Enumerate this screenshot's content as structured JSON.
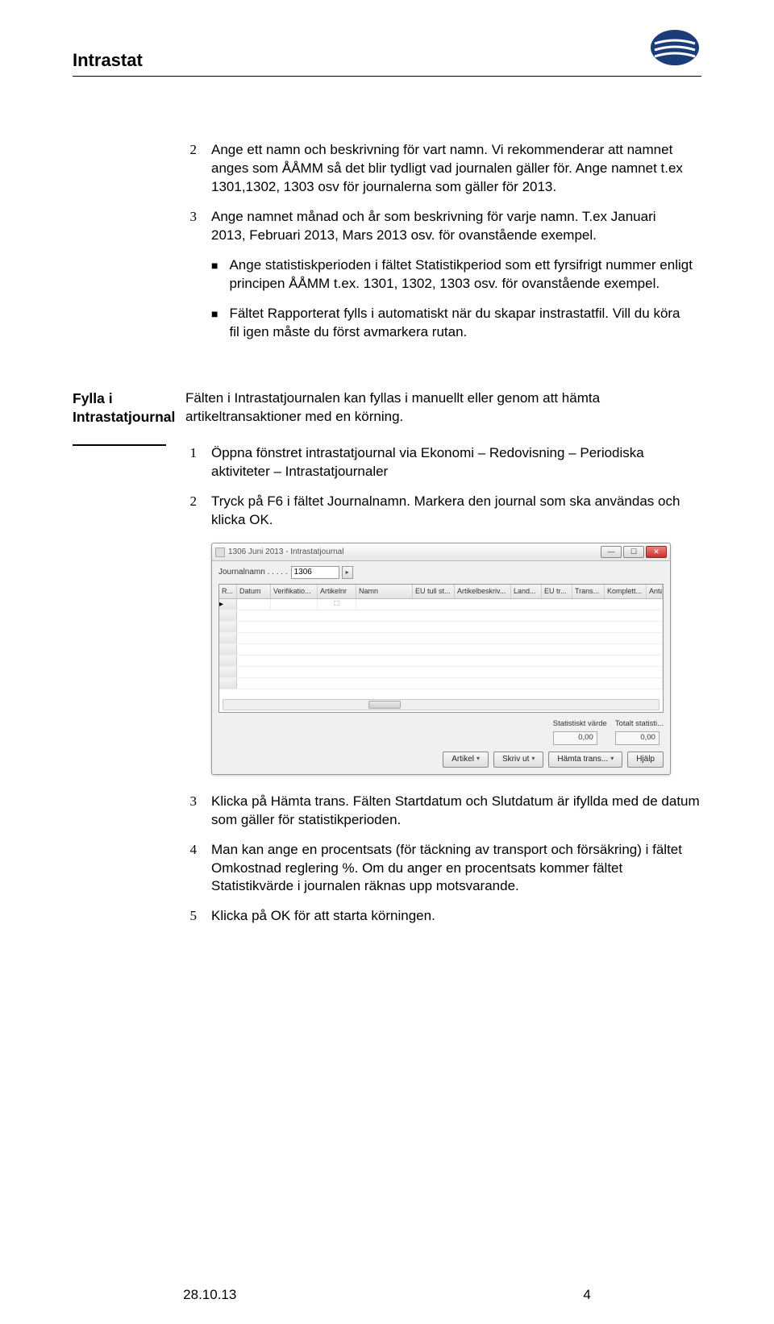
{
  "header": {
    "title": "Intrastat"
  },
  "list1": {
    "n2": {
      "num": "2",
      "text": "Ange ett namn och beskrivning för vart namn. Vi rekommenderar att namnet anges som ÅÅMM så det blir tydligt vad journalen gäller för. Ange namnet t.ex 1301,1302, 1303 osv för journalerna som gäller för 2013."
    },
    "n3": {
      "num": "3",
      "text": "Ange namnet månad och år som beskrivning för varje namn. T.ex Januari 2013, Februari 2013, Mars 2013 osv. för ovanstående exempel."
    },
    "b1": "Ange statistiskperioden i fältet Statistikperiod som ett fyrsifrigt nummer enligt principen ÅÅMM t.ex. 1301, 1302, 1303 osv. för ovanstående exempel.",
    "b2": "Fältet Rapporterat fylls i automatiskt när du skapar instrastatfil. Vill du köra fil igen måste du först avmarkera rutan."
  },
  "section2": {
    "label": "Fylla i  Intrastatjournal",
    "intro": "Fälten i Intrastatjournalen kan fyllas i manuellt eller genom att hämta artikeltransaktioner med en körning.",
    "n1": {
      "num": "1",
      "text": "Öppna fönstret intrastatjournal via Ekonomi – Redovisning – Periodiska aktiviteter – Intrastatjournaler"
    },
    "n2": {
      "num": "2",
      "text": "Tryck på F6 i fältet Journalnamn. Markera den journal som ska användas och klicka OK."
    },
    "n3": {
      "num": "3",
      "text": "Klicka på Hämta trans. Fälten Startdatum och Slutdatum är ifyllda med de datum som gäller för statistikperioden."
    },
    "n4": {
      "num": "4",
      "text": " Man kan ange en procentsats (för täckning av transport och försäkring) i fältet Omkostnad reglering %. Om du anger en procentsats kommer fältet Statistikvärde i journalen räknas upp motsvarande."
    },
    "n5": {
      "num": "5",
      "text": "Klicka på OK för att starta körningen."
    }
  },
  "app": {
    "title": "1306 Juni 2013 - Intrastatjournal",
    "field_label": "Journalnamn . . . . .",
    "field_value": "1306",
    "columns": [
      "R...",
      "Datum",
      "Verifikatio...",
      "Artikelnr",
      "Namn",
      "EU tull st...",
      "Artikelbeskriv...",
      "Land...",
      "EU tr...",
      "Trans...",
      "Komplett...",
      "Antal"
    ],
    "totals": {
      "label1": "Statistiskt värde",
      "label2": "Totalt statisti...",
      "val1": "0,00",
      "val2": "0,00"
    },
    "buttons": {
      "b1": "Artikel",
      "b2": "Skriv ut",
      "b3": "Hämta trans...",
      "b4": "Hjälp"
    }
  },
  "footer": {
    "date": "28.10.13",
    "page": "4"
  }
}
